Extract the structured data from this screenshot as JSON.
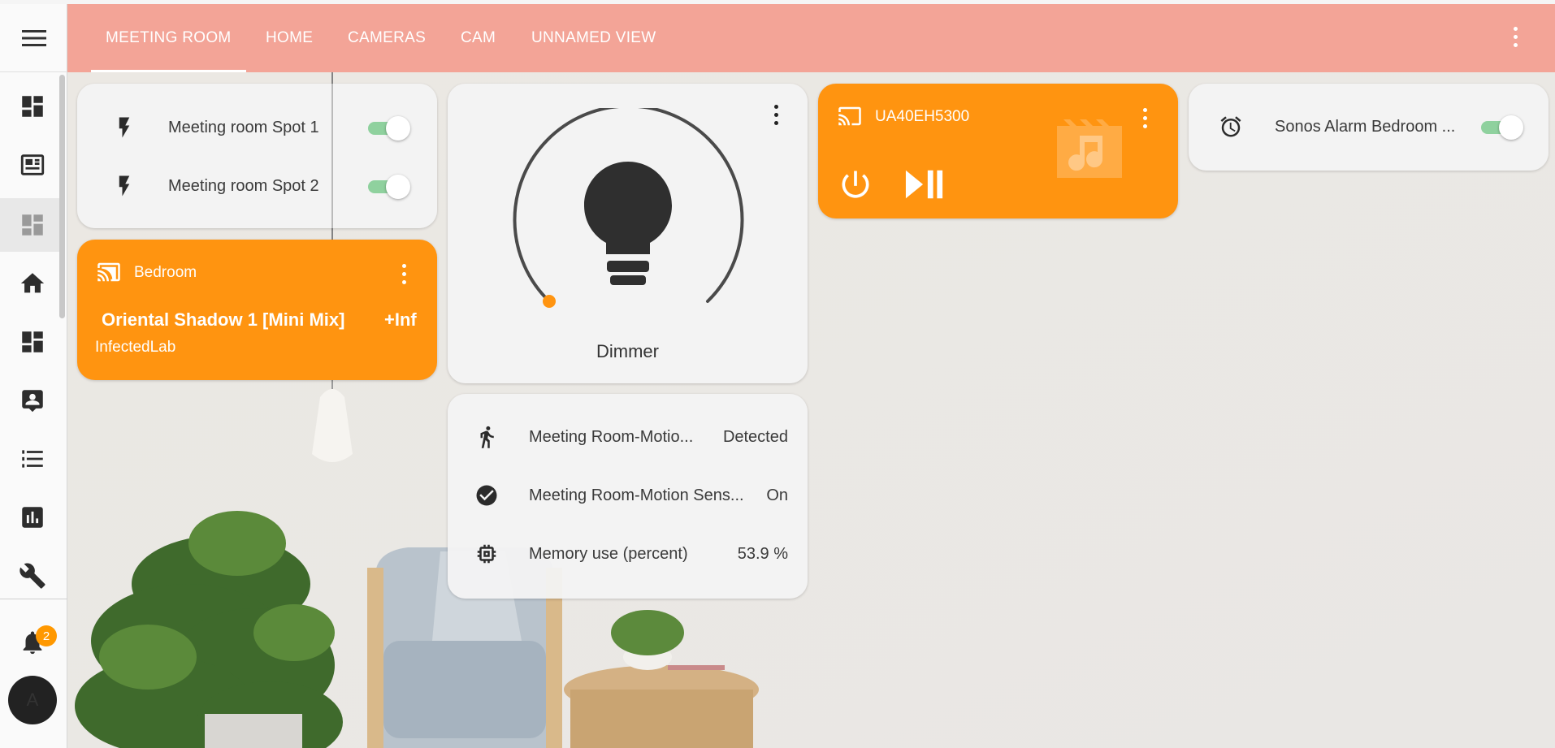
{
  "header": {
    "tabs": [
      {
        "label": "MEETING ROOM",
        "active": true
      },
      {
        "label": "HOME",
        "active": false
      },
      {
        "label": "CAMERAS",
        "active": false
      },
      {
        "label": "CAM",
        "active": false
      },
      {
        "label": "UNNAMED VIEW",
        "active": false
      }
    ],
    "color": "#f3a497"
  },
  "sidebar": {
    "items": [
      {
        "icon": "dashboard-icon"
      },
      {
        "icon": "newspaper-icon"
      },
      {
        "icon": "dashboard-icon",
        "active": true
      },
      {
        "icon": "home-icon"
      },
      {
        "icon": "dashboard-icon"
      },
      {
        "icon": "account-box-icon"
      },
      {
        "icon": "list-icon"
      },
      {
        "icon": "chart-icon"
      },
      {
        "icon": "wrench-icon"
      }
    ],
    "notifications_count": "2",
    "avatar_initial": "A"
  },
  "cards": {
    "spots": {
      "rows": [
        {
          "name": "Meeting room Spot 1",
          "icon": "flash-icon",
          "on": true
        },
        {
          "name": "Meeting room Spot 2",
          "icon": "flash-icon",
          "on": true
        }
      ]
    },
    "bedroom_media": {
      "title": "Bedroom",
      "track": "Oriental Shadow 1 [Mini Mix]",
      "track_overflow": "+Inf",
      "artist": "InfectedLab",
      "color": "#ff9410"
    },
    "dimmer": {
      "name": "Dimmer",
      "brightness_fraction": 0.0
    },
    "tv_media": {
      "title": "UA40EH5300",
      "color": "#ff9410"
    },
    "sensors": {
      "rows": [
        {
          "name": "Meeting Room-Motio...",
          "state": "Detected",
          "icon": "walk-icon"
        },
        {
          "name": "Meeting Room-Motion Sens...",
          "state": "On",
          "icon": "check-circle-icon"
        },
        {
          "name": "Memory use (percent)",
          "state": "53.9 %",
          "icon": "chip-icon"
        }
      ]
    },
    "alarm": {
      "name": "Sonos Alarm Bedroom ...",
      "icon": "alarm-icon",
      "on": true
    }
  }
}
